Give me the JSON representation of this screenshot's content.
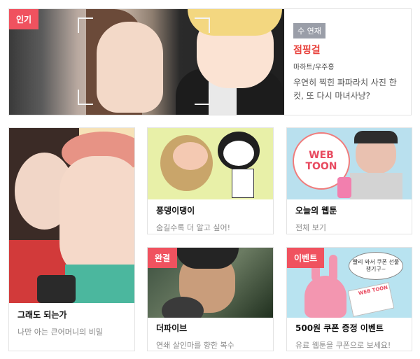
{
  "featured": {
    "badge": "인기",
    "status": "수 연재",
    "title": "점핑걸",
    "author": "마하트/우주홍",
    "description": "우연히 찍힌 파파라치 사진 한 컷, 또 다시 마녀사냥?"
  },
  "cards": [
    {
      "title": "그래도 되는가",
      "subtitle": "나만 아는 큰어머니의 비밀",
      "badge": ""
    },
    {
      "title": "풍뎅이댕이",
      "subtitle": "숨길수록 더 알고 싶어!",
      "badge": ""
    },
    {
      "title": "오늘의 웹툰",
      "subtitle": "전체 보기",
      "badge": "",
      "thumb_text": "WEB TOON"
    },
    {
      "title": "더파이브",
      "subtitle": "연쇄 살인마를 향한 복수",
      "badge": "완결"
    },
    {
      "title": "500원 쿠폰 증정 이벤트",
      "subtitle": "유료 웹툰을 쿠폰으로 보세요!",
      "badge": "이벤트",
      "bubble_text": "빨리 와서 쿠폰 선물 챙기구~",
      "stamp_text": "WEB TOON"
    }
  ],
  "colors": {
    "accent_red": "#f0525f",
    "title_red": "#e8413b",
    "status_gray": "#9a9ea8"
  }
}
